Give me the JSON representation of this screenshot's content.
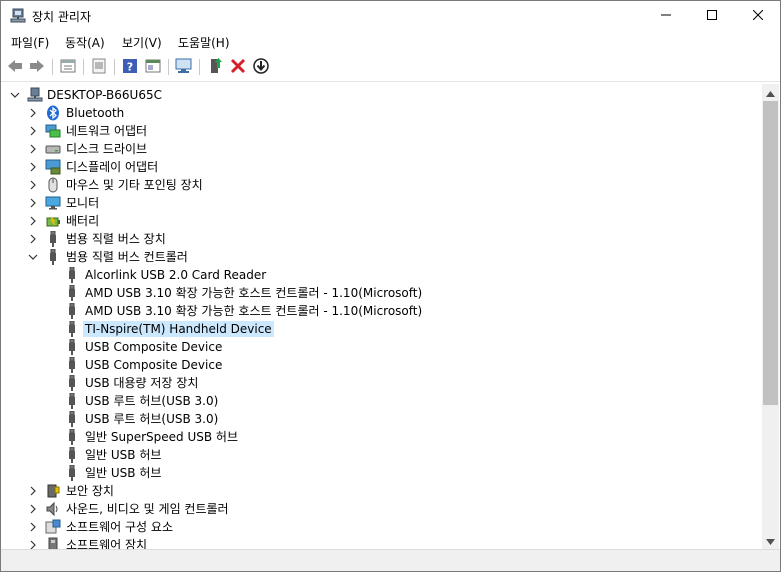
{
  "window": {
    "title": "장치 관리자",
    "icons": {
      "app": "device-manager-icon",
      "min": "minimize-icon",
      "max": "maximize-icon",
      "close": "close-icon"
    }
  },
  "menu": [
    {
      "label": "파일(F)"
    },
    {
      "label": "동작(A)"
    },
    {
      "label": "보기(V)"
    },
    {
      "label": "도움말(H)"
    }
  ],
  "toolbar": [
    "back-icon",
    "forward-icon",
    "properties-icon",
    "update-driver-icon",
    "help-icon",
    "view-icon",
    "scan-hardware-icon",
    "enable-device-icon",
    "uninstall-icon",
    "disable-device-icon"
  ],
  "tree": {
    "root": "DESKTOP-B66U65C",
    "items": [
      {
        "label": "Bluetooth",
        "icon": "bluetooth-icon",
        "level": 1,
        "state": "collapsed"
      },
      {
        "label": "네트워크 어댑터",
        "icon": "network-adapter-icon",
        "level": 1,
        "state": "collapsed"
      },
      {
        "label": "디스크 드라이브",
        "icon": "disk-drive-icon",
        "level": 1,
        "state": "collapsed"
      },
      {
        "label": "디스플레이 어댑터",
        "icon": "display-adapter-icon",
        "level": 1,
        "state": "collapsed"
      },
      {
        "label": "마우스 및 기타 포인팅 장치",
        "icon": "mouse-icon",
        "level": 1,
        "state": "collapsed"
      },
      {
        "label": "모니터",
        "icon": "monitor-icon",
        "level": 1,
        "state": "collapsed"
      },
      {
        "label": "배터리",
        "icon": "battery-icon",
        "level": 1,
        "state": "collapsed"
      },
      {
        "label": "범용 직렬 버스 장치",
        "icon": "usb-icon",
        "level": 1,
        "state": "collapsed"
      },
      {
        "label": "범용 직렬 버스 컨트롤러",
        "icon": "usb-icon",
        "level": 1,
        "state": "expanded"
      },
      {
        "label": "Alcorlink USB 2.0 Card Reader",
        "icon": "usb-icon",
        "level": 2
      },
      {
        "label": "AMD USB 3.10 확장 가능한 호스트 컨트롤러 - 1.10(Microsoft)",
        "icon": "usb-icon",
        "level": 2
      },
      {
        "label": "AMD USB 3.10 확장 가능한 호스트 컨트롤러 - 1.10(Microsoft)",
        "icon": "usb-icon",
        "level": 2
      },
      {
        "label": "TI-Nspire(TM) Handheld Device",
        "icon": "usb-icon",
        "level": 2,
        "selected": true
      },
      {
        "label": "USB Composite Device",
        "icon": "usb-icon",
        "level": 2
      },
      {
        "label": "USB Composite Device",
        "icon": "usb-icon",
        "level": 2
      },
      {
        "label": "USB 대용량 저장 장치",
        "icon": "usb-icon",
        "level": 2
      },
      {
        "label": "USB 루트 허브(USB 3.0)",
        "icon": "usb-icon",
        "level": 2
      },
      {
        "label": "USB 루트 허브(USB 3.0)",
        "icon": "usb-icon",
        "level": 2
      },
      {
        "label": "일반 SuperSpeed USB 허브",
        "icon": "usb-icon",
        "level": 2
      },
      {
        "label": "일반 USB 허브",
        "icon": "usb-icon",
        "level": 2
      },
      {
        "label": "일반 USB 허브",
        "icon": "usb-icon",
        "level": 2
      },
      {
        "label": "보안 장치",
        "icon": "security-device-icon",
        "level": 1,
        "state": "collapsed"
      },
      {
        "label": "사운드, 비디오 및 게임 컨트롤러",
        "icon": "speaker-icon",
        "level": 1,
        "state": "collapsed"
      },
      {
        "label": "소프트웨어 구성 요소",
        "icon": "software-component-icon",
        "level": 1,
        "state": "collapsed"
      },
      {
        "label": "소프트웨어 장치",
        "icon": "software-device-icon",
        "level": 1,
        "state": "collapsed"
      }
    ]
  },
  "colors": {
    "selection": "#cce8ff",
    "scroll_thumb": "#c1c1c1"
  }
}
